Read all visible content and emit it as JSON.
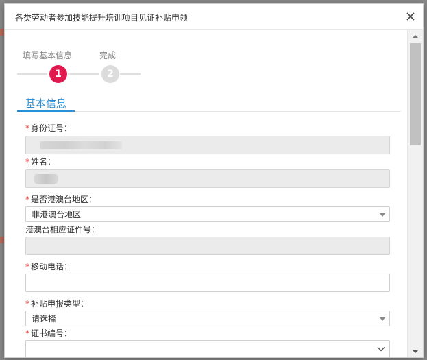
{
  "dialog": {
    "title": "各类劳动者参加技能提升培训项目见证补贴申领"
  },
  "steps": [
    {
      "number": "1",
      "label": "填写基本信息",
      "active": true
    },
    {
      "number": "2",
      "label": "完成",
      "active": false
    }
  ],
  "section": {
    "title": "基本信息"
  },
  "form": {
    "required_mark": "*",
    "id_number": {
      "label": "身份证号：",
      "value": ""
    },
    "name": {
      "label": "姓名：",
      "value": ""
    },
    "hk_macau_tw": {
      "label": "是否港澳台地区：",
      "selected": "非港澳台地区"
    },
    "hk_id_number": {
      "label": "港澳台相应证件号：",
      "value": ""
    },
    "mobile": {
      "label": "移动电话：",
      "value": ""
    },
    "subsidy_type": {
      "label": "补贴申报类型：",
      "selected": "请选择"
    },
    "certificate_no": {
      "label": "证书编号：",
      "selected": ""
    }
  },
  "colors": {
    "accent": "#2a8fd6",
    "active_step": "#e2194f",
    "required": "#e5322d"
  }
}
